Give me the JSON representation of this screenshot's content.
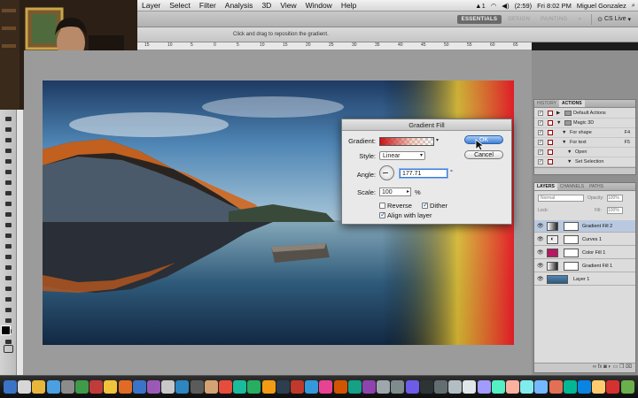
{
  "menubar": {
    "items": [
      "Layer",
      "Select",
      "Filter",
      "Analysis",
      "3D",
      "View",
      "Window",
      "Help"
    ],
    "battery": "(2:59)",
    "clock": "Fri 8:02 PM",
    "user": "Miguel Gonzalez"
  },
  "appbar": {
    "workspaces": [
      "ESSENTIALS",
      "DESIGN",
      "PAINTING"
    ],
    "more": "»",
    "cs_live": "CS Live"
  },
  "optionsbar": {
    "hint": "Click and drag to reposition the gradient."
  },
  "ruler": {
    "labels": [
      "15",
      "10",
      "5",
      "0",
      "5",
      "10",
      "15",
      "20",
      "25",
      "30",
      "35",
      "40",
      "45",
      "50",
      "55",
      "60",
      "65",
      "70"
    ]
  },
  "dialog": {
    "title": "Gradient Fill",
    "gradient_label": "Gradient:",
    "style_label": "Style:",
    "style_value": "Linear",
    "angle_label": "Angle:",
    "angle_value": "177.71",
    "degree": "°",
    "scale_label": "Scale:",
    "scale_value": "100",
    "percent": "%",
    "reverse_label": "Reverse",
    "dither_label": "Dither",
    "align_label": "Align with layer",
    "ok_label": "OK",
    "cancel_label": "Cancel",
    "reverse_checked": false,
    "dither_checked": true,
    "align_checked": true
  },
  "history_panel": {
    "tabs": [
      "HISTORY",
      "ACTIONS"
    ],
    "active_tab": "ACTIONS",
    "rows": [
      {
        "text": "Default Actions",
        "indent": 0,
        "type": "folder"
      },
      {
        "text": "Magic 3D",
        "indent": 0,
        "type": "folder-open"
      },
      {
        "text": "For shape",
        "indent": 1,
        "key": "F4"
      },
      {
        "text": "For text",
        "indent": 1,
        "key": "F5"
      },
      {
        "text": "Open",
        "indent": 2
      },
      {
        "text": "Set Selection",
        "indent": 2
      }
    ]
  },
  "layers_panel": {
    "tabs": [
      "LAYERS",
      "CHANNELS",
      "PATHS"
    ],
    "active_tab": "LAYERS",
    "blend_mode": "Normal",
    "opacity_label": "Opacity:",
    "opacity_value": "100%",
    "lock_label": "Lock:",
    "fill_label": "Fill:",
    "fill_value": "100%",
    "layers": [
      {
        "name": "Gradient Fill 2",
        "thumb": "gradient",
        "selected": true
      },
      {
        "name": "Curves 1",
        "thumb": "curves"
      },
      {
        "name": "Color Fill 1",
        "thumb": "color",
        "color": "#b5195f"
      },
      {
        "name": "Gradient Fill 1",
        "thumb": "gradient"
      },
      {
        "name": "Layer 1",
        "thumb": "photo"
      }
    ]
  },
  "colors": {
    "accent": "#3d7fd6",
    "gradient_red": "#e81a24",
    "gradient_yellow": "#e9c32c"
  }
}
